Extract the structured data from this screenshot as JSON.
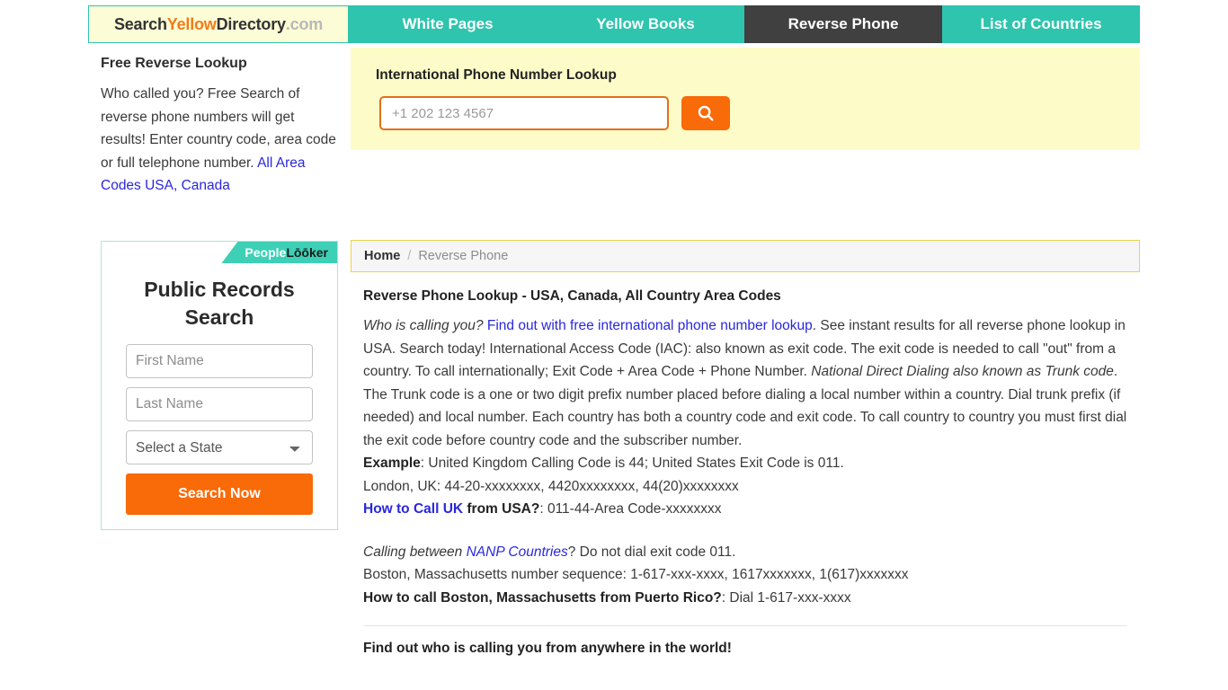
{
  "header": {
    "logo": {
      "part1": "Search",
      "part2": "Yellow",
      "part3": "Directory",
      "part4": ".com"
    },
    "nav": [
      {
        "label": "White Pages",
        "active": false
      },
      {
        "label": "Yellow Books",
        "active": false
      },
      {
        "label": "Reverse Phone",
        "active": true
      },
      {
        "label": "List of Countries",
        "active": false
      }
    ],
    "accent_teal": "#2ec4ad",
    "active_tab_bg": "#404040"
  },
  "sidebar": {
    "title": "Free Reverse Lookup",
    "body": "Who called you? Free Search of reverse phone numbers will get results! Enter country code, area code or full telephone number.",
    "link": "All Area Codes USA, Canada",
    "link_color": "#2a27dd"
  },
  "search": {
    "heading": "International Phone Number Lookup",
    "placeholder": "+1 202 123 4567",
    "value": "",
    "button_icon": "search-icon",
    "button_color": "#f96a09",
    "panel_bg": "#fdfcc8"
  },
  "widget": {
    "brand_part1": "People",
    "brand_part2": "Lōōker",
    "title": "Public Records Search",
    "first_name_placeholder": "First Name",
    "first_name_value": "",
    "last_name_placeholder": "Last Name",
    "last_name_value": "",
    "state_selected": "Select a State",
    "state_options": [
      "Select a State"
    ],
    "submit_label": "Search Now",
    "banner_color": "#3dd0b6",
    "submit_color": "#f96a09"
  },
  "breadcrumb": {
    "home": "Home",
    "separator": "/",
    "current": "Reverse Phone"
  },
  "article": {
    "title": "Reverse Phone Lookup - USA, Canada, All Country Area Codes",
    "p1_italic_lead": "Who is calling you?",
    "p1_link": "Find out with free international phone number lookup",
    "p1_after_link": ". See instant results for all reverse phone lookup in USA. Search today! International Access Code (IAC): also known as exit code. The exit code is needed to call \"out\" from a country. To call internationally; Exit Code + Area Code + Phone Number. ",
    "p1_italic_2": "National Direct Dialing also known as Trunk code",
    "p1_tail": ". The Trunk code is a one or two digit prefix number placed before dialing a local number within a country. Dial trunk prefix (if needed) and local number. Each country has both a country code and exit code. To call country to country you must first dial the exit code before country code and the subscriber number.",
    "example_label": "Example",
    "example_text": ": United Kingdom Calling Code is 44; United States Exit Code is 011.",
    "london_line": "London, UK: 44-20-xxxxxxxx, 4420xxxxxxxx, 44(20)xxxxxxxx",
    "uk_link": "How to Call UK",
    "uk_bold_rest": " from USA?",
    "uk_tail": ": 011-44-Area Code-xxxxxxxx",
    "nanp_lead": "Calling between ",
    "nanp_link": "NANP Countries",
    "nanp_tail": "? Do not dial exit code 011.",
    "boston_line": "Boston, Massachusetts number sequence: 1-617-xxx-xxxx, 1617xxxxxxx, 1(617)xxxxxxx",
    "boston_bold": "How to call Boston, Massachusetts from Puerto Rico?",
    "boston_tail": ": Dial 1-617-xxx-xxxx",
    "footer_heading": "Find out who is calling you from anywhere in the world!"
  }
}
